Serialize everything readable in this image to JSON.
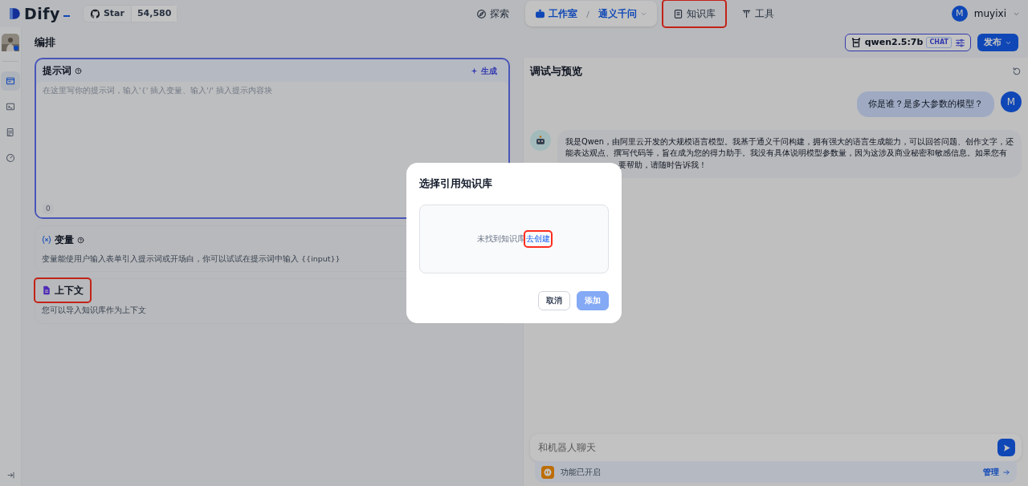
{
  "topbar": {
    "logo": "Dify",
    "github": {
      "label": "Star",
      "count": "54,580"
    },
    "nav": [
      {
        "kind": "link",
        "label": "探索",
        "selected": false,
        "highlighted": false
      },
      {
        "kind": "breadcrumb",
        "label": "工作室",
        "app": "通义千问",
        "selected": true,
        "highlighted": false
      },
      {
        "kind": "link",
        "label": "知识库",
        "selected": false,
        "highlighted": true
      },
      {
        "kind": "link",
        "label": "工具",
        "selected": false,
        "highlighted": false
      }
    ],
    "user": {
      "initial": "M",
      "name": "muyixi"
    }
  },
  "sidebar": {
    "items": [
      {
        "kind": "layout",
        "selected": true
      },
      {
        "kind": "terminal",
        "selected": false
      },
      {
        "kind": "log",
        "selected": false
      },
      {
        "kind": "monitor",
        "selected": false
      }
    ]
  },
  "header": {
    "title": "编排",
    "model": {
      "name": "qwen2.5:7b",
      "mode": "CHAT"
    },
    "publish": "发布"
  },
  "prompt": {
    "title": "提示词",
    "generate": "生成",
    "placeholder": "在这里写你的提示词，输入'{' 插入变量、输入'/' 插入提示内容块",
    "count": "0"
  },
  "variables": {
    "title": "变量",
    "description": "变量能使用户输入表单引入提示词或开场白，你可以试试在提示词中输入 {{input}}"
  },
  "context": {
    "title": "上下文",
    "highlighted": true,
    "description": "您可以导入知识库作为上下文"
  },
  "preview": {
    "title": "调试与预览",
    "messages": [
      {
        "kind": "user",
        "initial": "M",
        "lines": [
          {
            "text": "你是谁？是多大参数的模型？",
            "partial": false
          }
        ]
      },
      {
        "kind": "assistant",
        "lines": [
          {
            "text": "我是Qwen，由阿里云开发的大规模语言模型。我基于通义千问构建，拥有强大的语言生成能力，可以回答问题、创作文字，还",
            "partial": false
          },
          {
            "text": "能表达观点、撰写代码等，旨在成为您的得力助手。我没有具体说明模型参数量，因为这涉及商业秘密和敏感信息。如果您有",
            "partial": false
          },
          {
            "text": "要帮助，请随时告诉我！",
            "partial": true
          }
        ]
      }
    ],
    "input": {
      "placeholder": "和机器人聊天"
    },
    "features": {
      "label": "功能已开启",
      "manage": "管理"
    }
  },
  "dialog": {
    "title": "选择引用知识库",
    "empty_text": "未找到知识库",
    "create_link": {
      "label": "去创建",
      "highlighted": true
    },
    "buttons": [
      {
        "label": "取消",
        "disabled": false
      },
      {
        "label": "添加",
        "disabled": true
      }
    ]
  }
}
